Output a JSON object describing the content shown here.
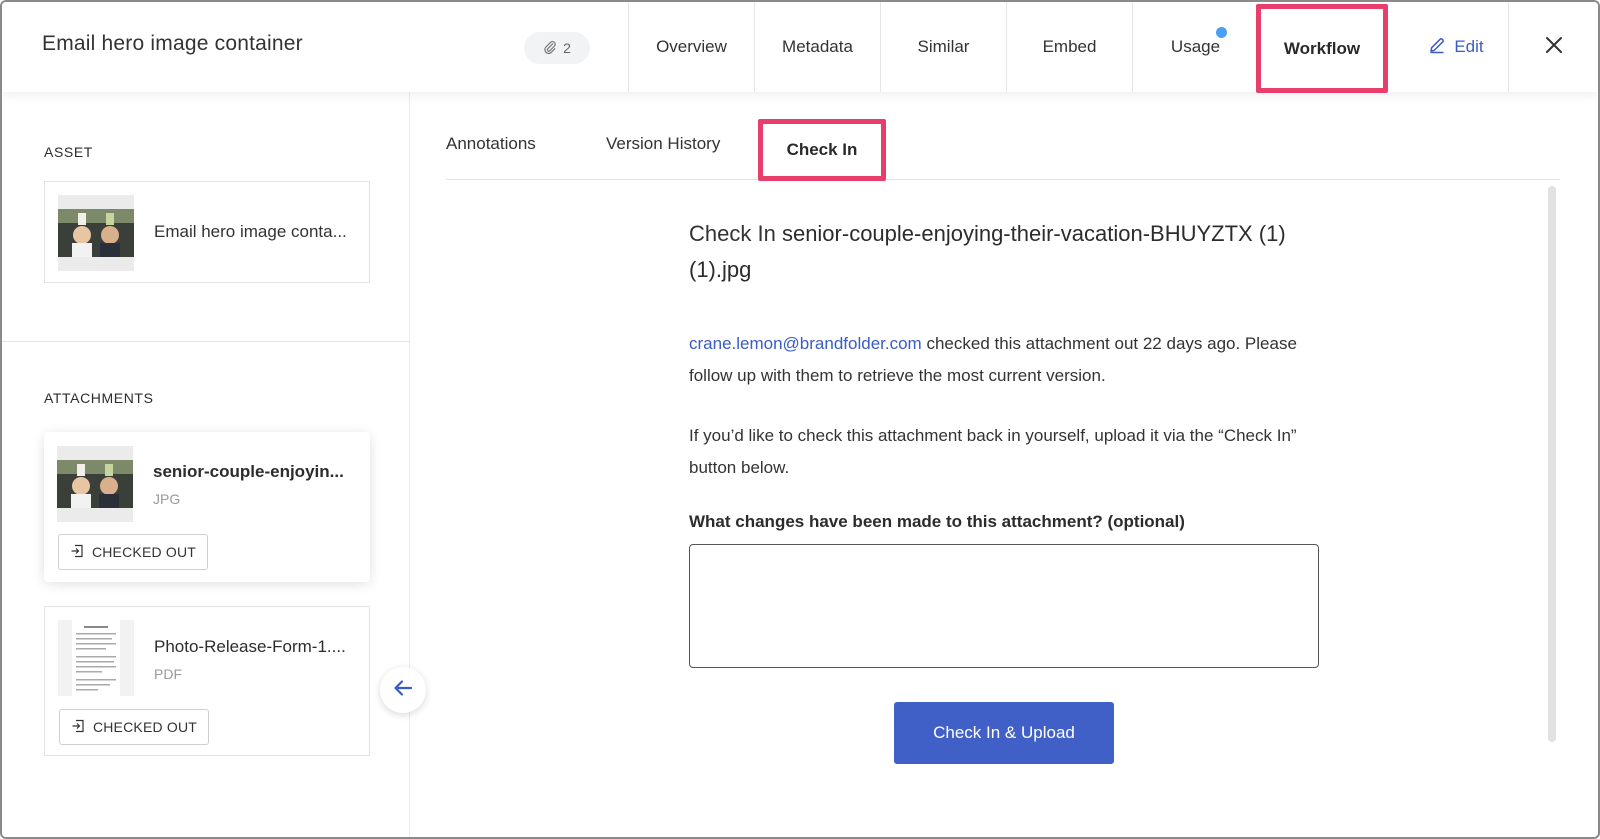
{
  "header": {
    "title": "Email hero image container",
    "attachment_count": "2",
    "tabs": [
      "Overview",
      "Metadata",
      "Similar",
      "Embed",
      "Usage",
      "Workflow"
    ],
    "edit_label": "Edit"
  },
  "sidebar": {
    "asset_section_label": "ASSET",
    "asset_name": "Email hero image conta...",
    "attachments_section_label": "ATTACHMENTS",
    "attachments": [
      {
        "name": "senior-couple-enjoyin...",
        "type": "JPG",
        "status": "CHECKED OUT"
      },
      {
        "name": "Photo-Release-Form-1....",
        "type": "PDF",
        "status": "CHECKED OUT"
      }
    ]
  },
  "main": {
    "subtabs": [
      "Annotations",
      "Version History",
      "Check In"
    ],
    "heading_prefix": "Check In",
    "heading_filename": "senior-couple-enjoying-their-vacation-BHUYZTX (1) (1).jpg",
    "checked_out_by": "crane.lemon@brandfolder.com",
    "checked_out_text": "checked this attachment out 22 days ago. Please follow up with them to retrieve the most current version.",
    "self_checkin_text": "If you’d like to check this attachment back in yourself, upload it via the “Check In” button below.",
    "changes_label": "What changes have been made to this attachment? (optional)",
    "changes_value": "",
    "upload_button": "Check In & Upload"
  },
  "colors": {
    "accent": "#4060c8",
    "highlight": "#e83e6c",
    "link": "#3a5cc5",
    "notification_dot": "#4a9ff5"
  }
}
